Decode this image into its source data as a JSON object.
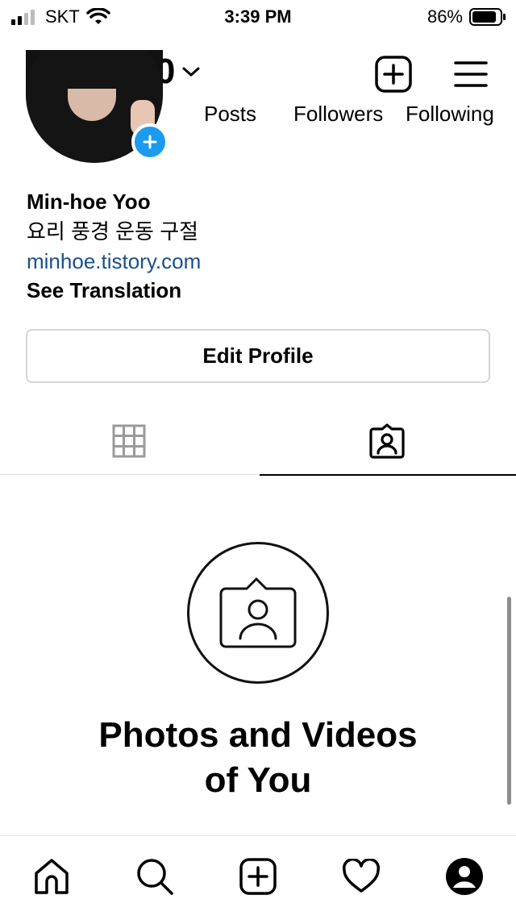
{
  "status_bar": {
    "carrier": "SKT",
    "time": "3:39 PM",
    "battery": "86%",
    "icons": [
      "signal-icon",
      "wifi-icon",
      "battery-icon"
    ]
  },
  "header": {
    "username": "ymh3190",
    "icons": [
      "chevron-down-icon",
      "new-post-icon",
      "menu-icon"
    ]
  },
  "profile": {
    "stats": {
      "posts_label": "Posts",
      "followers_label": "Followers",
      "following_label": "Following"
    },
    "name": "Min-hoe Yoo",
    "bio": "요리 풍경 운동 구절",
    "link": "minhoe.tistory.com",
    "see_translation": "See Translation",
    "edit_profile": "Edit Profile"
  },
  "tabs": {
    "items": [
      {
        "icon": "grid-icon",
        "active": false
      },
      {
        "icon": "tagged-icon",
        "active": true
      }
    ]
  },
  "empty_state": {
    "icon": "tagged-icon",
    "title_line1": "Photos and Videos",
    "title_line2": "of You"
  },
  "bottom_nav": {
    "items": [
      "home-icon",
      "search-icon",
      "new-post-icon",
      "heart-icon",
      "profile-icon"
    ]
  },
  "colors": {
    "accent_blue": "#1a9bf0",
    "link_blue": "#1b4f8a",
    "border_gray": "#d6d6d6"
  }
}
